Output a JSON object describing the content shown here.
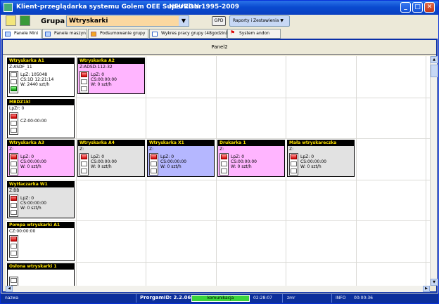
{
  "window": {
    "title": "Klient-przeglądarka systemu Golem OEE SuperVisor",
    "subtitle": "NEURON 1995-2009",
    "minimize_label": "_",
    "maximize_label": "□",
    "close_label": "✕"
  },
  "toolbar": {
    "grupa_label": "Grupa",
    "grupa_value": "Wtryskarki",
    "gpd_label": "GPD",
    "raporty_label": "Raporty i Zestawienia ▼"
  },
  "tabs": [
    {
      "label": "Panele Mini",
      "icon": "panel-icon"
    },
    {
      "label": "Panele maszyn",
      "icon": "panel-icon"
    },
    {
      "label": "Podsumowanie grupy",
      "icon": "summary-icon"
    },
    {
      "label": "Wykres pracy grupy (48godzin)",
      "icon": "chart-icon"
    },
    {
      "label": "System andon",
      "icon": "flag-icon"
    }
  ],
  "panel": {
    "title": "Panel2"
  },
  "cards": [
    {
      "name": "Wtryskarka A1",
      "color": "white",
      "z": "Z:ASDF_11",
      "lines": [
        "LpZ: 105048",
        "CS:1D 12:21:14",
        "W: 2440 szt/h"
      ],
      "lamp": [
        "white",
        "white",
        "green"
      ]
    },
    {
      "name": "Wtryskarka A2",
      "color": "pink",
      "z": "Z:ADSD-112-32",
      "lines": [
        "LpZ: 0",
        "CS:00:00:00",
        "W: 0 szt/h"
      ],
      "lamp": [
        "red",
        "white",
        "white"
      ]
    },
    {
      "name": "MBDZ1kl",
      "color": "white",
      "z": "LpZr: 0",
      "lines": [
        "",
        "CZ:00:00:00",
        ""
      ],
      "lamp": [
        "red",
        "white",
        "white"
      ]
    },
    {
      "name": "Wtryskarka A3",
      "color": "pink",
      "z": "Z:",
      "lines": [
        "LpZ: 0",
        "CS:00:00:00",
        "W: 0 szt/h"
      ],
      "lamp": [
        "red",
        "white",
        "white"
      ]
    },
    {
      "name": "Wtryskarka A4",
      "color": "grey",
      "z": "Z:",
      "lines": [
        "LpZ: 0",
        "CS:00:00:00",
        "W: 0 szt/h"
      ],
      "lamp": [
        "red",
        "white",
        "white"
      ]
    },
    {
      "name": "Wtryskarka X1",
      "color": "blue",
      "z": "Z:",
      "lines": [
        "LpZ: 0",
        "CS:00:00:00",
        "W: 0 szt/h"
      ],
      "lamp": [
        "red",
        "white",
        "white"
      ]
    },
    {
      "name": "Drukarka 1",
      "color": "pink",
      "z": "Z:",
      "lines": [
        "LpZ: 0",
        "CS:00:00:00",
        "W: 0 szt/h"
      ],
      "lamp": [
        "red",
        "white",
        "white"
      ]
    },
    {
      "name": "Mała wtryskareczka",
      "color": "grey",
      "z": "Z:",
      "lines": [
        "LpZ: 0",
        "CS:00:00:00",
        "W: 0 szt/h"
      ],
      "lamp": [
        "red",
        "white",
        "white"
      ]
    },
    {
      "name": "Wytłaczarka W1",
      "color": "grey",
      "z": "Z:BB",
      "lines": [
        "LpZ: 0",
        "CS:00:00:00",
        "W: 0 szt/h"
      ],
      "lamp": [
        "red",
        "white",
        "white"
      ]
    },
    {
      "name": "Pompa wtryskarki A1",
      "color": "white",
      "z": "CZ:00:00:00",
      "lines": [
        "",
        "",
        ""
      ],
      "lamp": [
        "red",
        "white",
        "white"
      ]
    },
    {
      "name": "Osłona wtryskarki 1",
      "color": "white",
      "z": "",
      "lines": [
        "",
        "",
        ""
      ],
      "lamp": [
        "white",
        "white",
        "white"
      ]
    }
  ],
  "status": {
    "nazwa": "nazwa",
    "program_id": "ProrgamID: 2.2.06",
    "komunikacja": "komunikacja",
    "time1": "02:28:07",
    "zmr": "zmr",
    "info": "INFO",
    "time2": "00:00:36"
  },
  "colors": {
    "pink": "#ffb5ff",
    "grey": "#e2e2e2",
    "blue": "#b5b7ff",
    "white": "#ffffff",
    "name_text": "#ffe500",
    "statusbar": "#0c2f9c",
    "komunikacja": "#3bd43b"
  }
}
